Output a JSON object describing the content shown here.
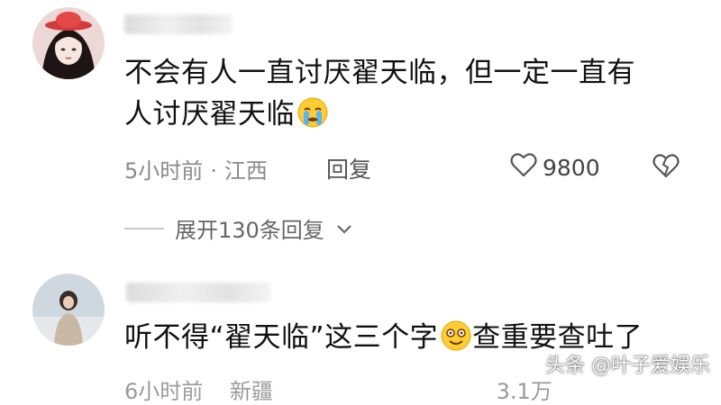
{
  "comments": [
    {
      "text_line1": "不会有人一直讨厌翟天临，但一定一直有",
      "text_line2": "人讨厌翟天临",
      "emoji": "crying-face-icon",
      "time": "5小时前",
      "separator": "·",
      "location": "江西",
      "reply_label": "回复",
      "likes": "9800",
      "expand_label": "展开130条回复"
    },
    {
      "text": "听不得“翟天临”这三个字",
      "text_after": "查重要查吐了",
      "emoji": "dizzy-smile-icon",
      "time_partial": "6小时前",
      "location_partial": "新疆",
      "likes_partial": "3.1万"
    }
  ],
  "watermark": "头条 @叶子爱娱乐",
  "colors": {
    "text": "#111111",
    "meta": "#8a8a8a",
    "accent_hat": "#e23b3b"
  }
}
